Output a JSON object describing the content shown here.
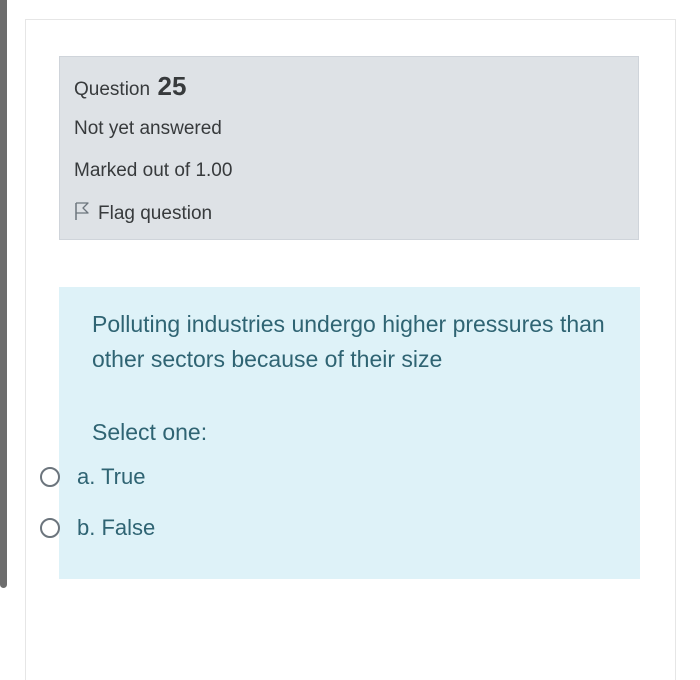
{
  "question": {
    "label": "Question",
    "number": "25",
    "state": "Not yet answered",
    "grade": "Marked out of 1.00",
    "flag_label": "Flag question"
  },
  "content": {
    "text": "Polluting industries undergo higher pressures than other sectors because of their size",
    "prompt": "Select one:",
    "options": [
      {
        "label": "a. True",
        "selected": false
      },
      {
        "label": "b. False",
        "selected": false
      }
    ]
  },
  "colors": {
    "info_bg": "#dee2e6",
    "content_bg": "#def2f8",
    "content_text": "#2f6473"
  },
  "icons": {
    "flag": "flag-outline-icon",
    "radio": "radio-unchecked-icon"
  }
}
